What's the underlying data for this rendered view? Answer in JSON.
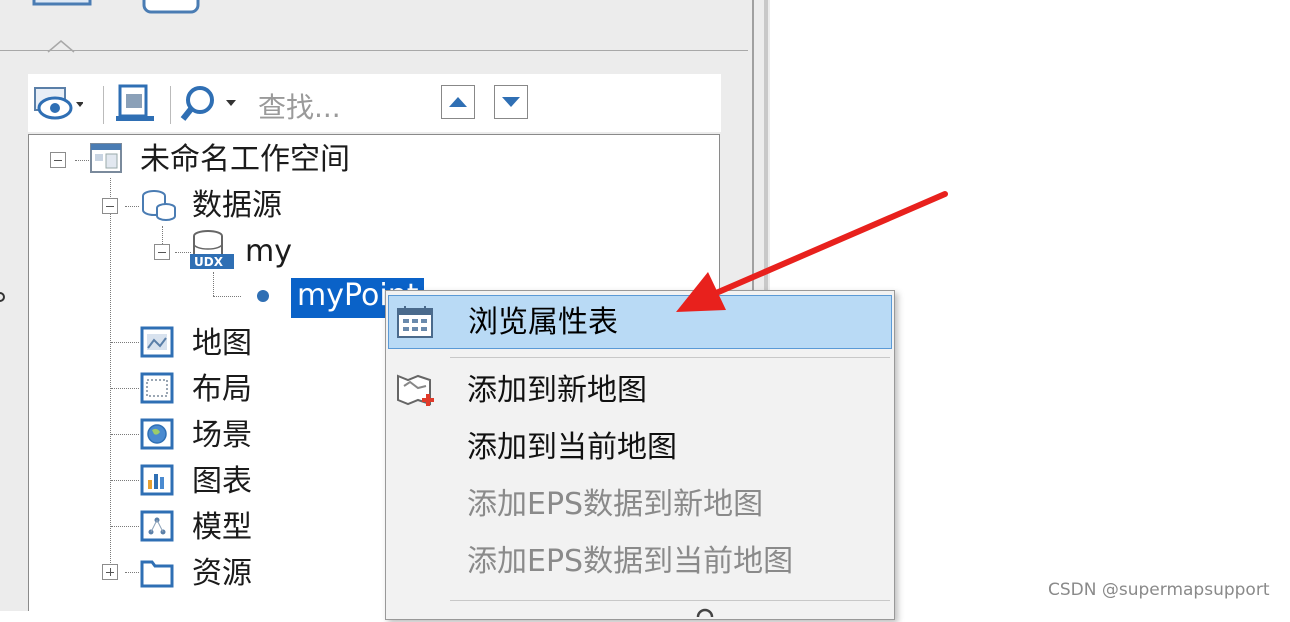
{
  "toolbar": {
    "search_placeholder": "查找...",
    "icons": [
      "visibility-icon",
      "dropdown-arrow-icon",
      "map-window-icon",
      "search-icon",
      "move-up-icon",
      "move-down-icon"
    ]
  },
  "tree": {
    "workspace": "未命名工作空间",
    "datasources": "数据源",
    "datasource": "my",
    "dataset": "myPoint",
    "maps": "地图",
    "layouts": "布局",
    "scenes": "场景",
    "charts": "图表",
    "models": "模型",
    "resources": "资源"
  },
  "context_menu": {
    "items": [
      {
        "label": "浏览属性表",
        "enabled": true,
        "highlighted": true
      },
      {
        "label": "添加到新地图",
        "enabled": true
      },
      {
        "label": "添加到当前地图",
        "enabled": true
      },
      {
        "label": "添加EPS数据到新地图",
        "enabled": false
      },
      {
        "label": "添加EPS数据到当前地图",
        "enabled": false
      }
    ]
  },
  "annotation": {
    "arrow_color": "#e8211d"
  },
  "colors": {
    "selection": "#0a62c8",
    "menu_highlight": "#b9daf5"
  },
  "watermark": "CSDN @supermapsupport"
}
